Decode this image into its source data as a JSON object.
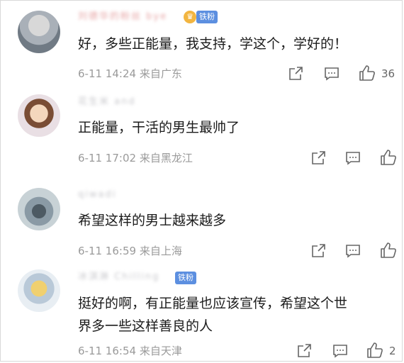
{
  "comments": [
    {
      "username": "刘德华的粉丝 bye",
      "badge": "铁粉",
      "text": "好，多些正能量，我支持，学这个，学好的！",
      "date": "6-11 14:24",
      "location": "来自广东",
      "likes": "36"
    },
    {
      "username": "花生米 and",
      "text": "正能量，干活的男生最帅了",
      "date": "6-11 17:02",
      "location": "来自黑龙江"
    },
    {
      "username": "qiwadi",
      "text": "希望这样的男士越来越多",
      "date": "6-11 16:59",
      "location": "来自上海"
    },
    {
      "username": "冰淇淋 Chilling",
      "badge": "铁粉",
      "text_line1": "挺好的啊，有正能量也应该宣传，希望这个世",
      "text_line2": "界多一些这样善良的人",
      "date": "6-11 16:54",
      "location": "来自天津",
      "likes": "2"
    }
  ],
  "icons": {
    "share": "share-icon",
    "comment": "comment-icon",
    "like": "thumbs-up-icon"
  }
}
